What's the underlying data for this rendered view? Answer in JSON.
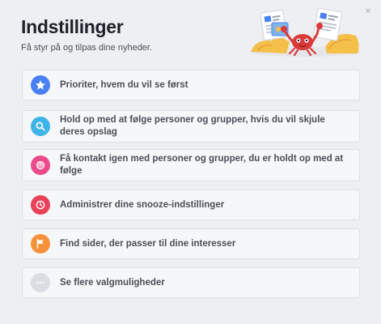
{
  "dialog": {
    "title": "Indstillinger",
    "subtitle": "Få styr på og tilpas dine nyheder.",
    "close_glyph": "×"
  },
  "options": [
    {
      "label": "Prioriter, hvem du vil se først",
      "icon": "star-icon",
      "color": "#4a80f5"
    },
    {
      "label": "Hold op med at følge personer og grupper, hvis du vil skjule deres opslag",
      "icon": "search-icon",
      "color": "#3eb4e8"
    },
    {
      "label": "Få kontakt igen med personer og grupper, du er holdt op med at følge",
      "icon": "smiley-icon",
      "color": "#ea4c89"
    },
    {
      "label": "Administrer dine snooze-indstillinger",
      "icon": "clock-icon",
      "color": "#e9425a"
    },
    {
      "label": "Find sider, der passer til dine interesser",
      "icon": "flag-icon",
      "color": "#f7923a"
    },
    {
      "label": "Se flere valgmuligheder",
      "icon": "more-icon",
      "color": "#dadde1"
    }
  ]
}
